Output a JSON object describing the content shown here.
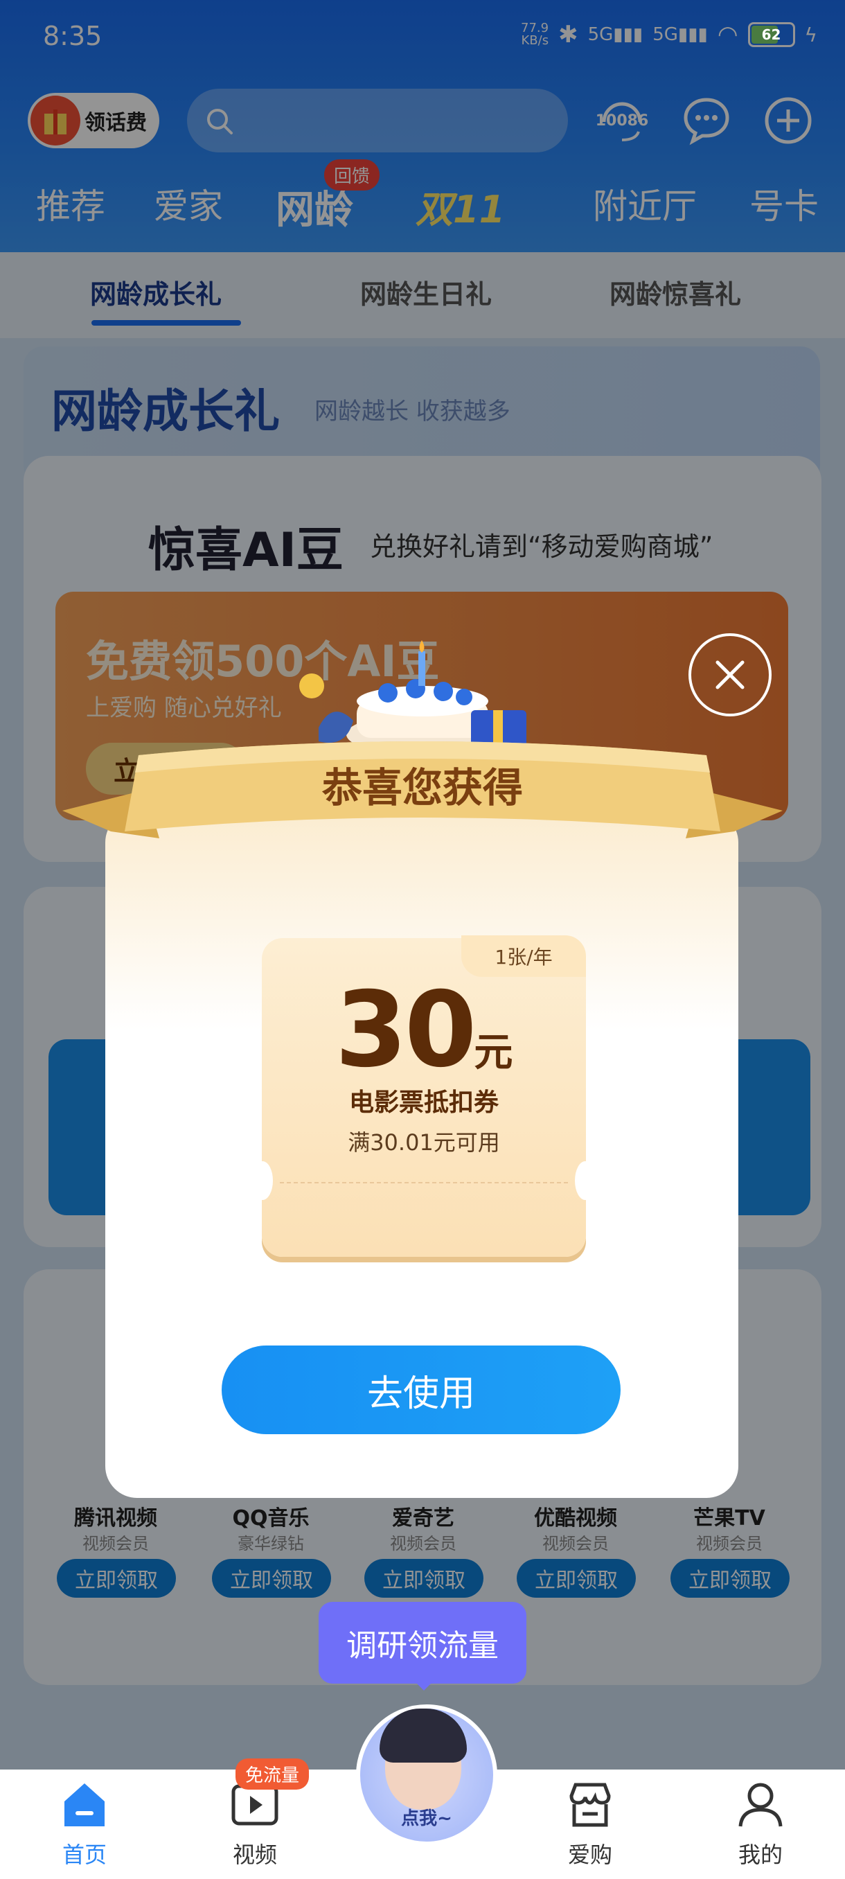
{
  "status_bar": {
    "time": "8:35",
    "net_speed": "77.9\nKB/s",
    "battery": "62"
  },
  "header": {
    "huafei_label": "领话费",
    "hotline": "10086",
    "tabs": [
      "推荐",
      "爱家",
      "网龄",
      "双11",
      "附近厅",
      "号卡"
    ],
    "tab_badge": "回馈"
  },
  "subtabs": [
    "网龄成长礼",
    "网龄生日礼",
    "网龄惊喜礼"
  ],
  "banner": {
    "title": "网龄成长礼",
    "subtitle": "网龄越长 收获越多"
  },
  "ai_card": {
    "title": "惊喜AI豆",
    "subtitle": "兑换好礼请到“移动爱购商城”",
    "promo_title": "免费领500个AI豆",
    "promo_sub": "上爱购 随心兑好礼",
    "promo_btn": "立即领取"
  },
  "modal": {
    "ribbon": "恭喜您获得",
    "coupon_tag": "1张/年",
    "amount": "30",
    "unit": "元",
    "name": "电影票抵扣券",
    "condition": "满30.01元可用",
    "use_button": "去使用"
  },
  "vip_items": [
    {
      "name": "腾讯视频",
      "sub": "视频会员",
      "btn": "立即领取"
    },
    {
      "name": "QQ音乐",
      "sub": "豪华绿钻",
      "btn": "立即领取"
    },
    {
      "name": "爱奇艺",
      "sub": "视频会员",
      "btn": "立即领取"
    },
    {
      "name": "优酷视频",
      "sub": "视频会员",
      "btn": "立即领取"
    },
    {
      "name": "芒果TV",
      "sub": "视频会员",
      "btn": "立即领取"
    }
  ],
  "survey": "调研领流量",
  "bottom_nav": {
    "home": "首页",
    "video": "视频",
    "video_badge": "免流量",
    "assistant": "点我~",
    "shop": "爱购",
    "mine": "我的"
  },
  "colors": {
    "primary": "#1a6df0",
    "button": "#1790f3",
    "coupon_text": "#5c2c08",
    "survey": "#6f6ff8"
  }
}
